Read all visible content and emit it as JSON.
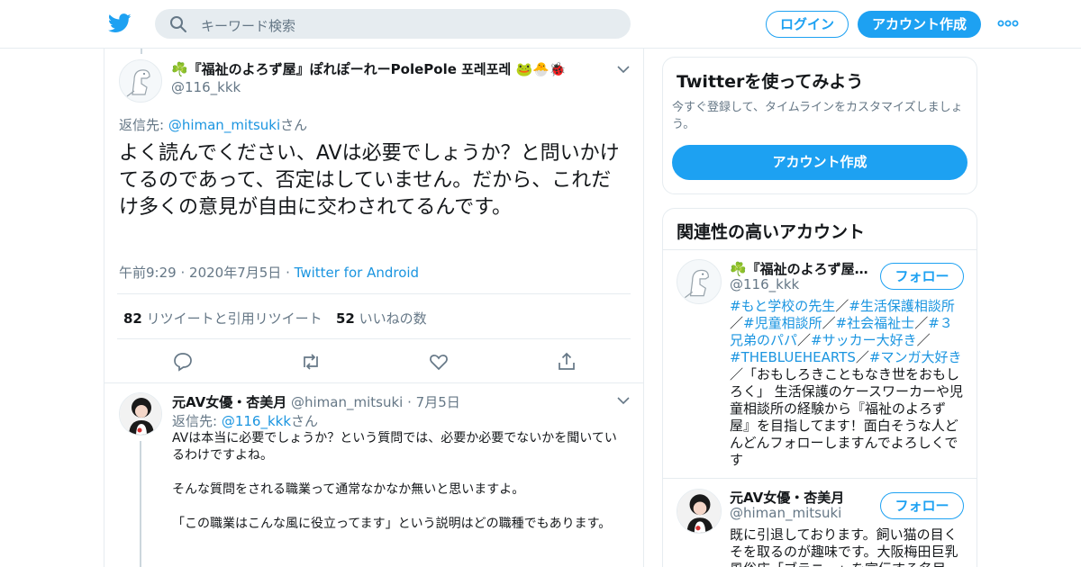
{
  "topbar": {
    "search_placeholder": "キーワード検索",
    "login": "ログイン",
    "signup": "アカウント作成"
  },
  "tweet": {
    "name": "☘️『福祉のよろず屋』ぽれぽーれーPolePole 포레포레",
    "emoji": "🐸🐣🐞",
    "handle": "@116_kkk",
    "reply_prefix": "返信先: ",
    "reply_link": "@himan_mitsuki",
    "reply_suffix": "さん",
    "text": "よく読んでください、AVは必要でしょうか？と問いかけてるのであって、否定はしていません。だから、これだけ多くの意見が自由に交わされてるんです。",
    "time": "午前9:29",
    "date": "2020年7月5日",
    "source": "Twitter for Android",
    "retweets_count": "82",
    "retweets_label": "リツイートと引用リツイート",
    "likes_count": "52",
    "likes_label": "いいねの数"
  },
  "reply": {
    "name": "元AV女優・杏美月",
    "handle": "@himan_mitsuki",
    "date": "7月5日",
    "reply_prefix": "返信先: ",
    "reply_link": "@116_kkk",
    "reply_suffix": "さん",
    "paragraphs": [
      "AVは本当に必要でしょうか？という質問では、必要か必要でないかを聞いているわけですよね。",
      "そんな質問をされる職業って通常なかなか無いと思いますよ。",
      "「この職業はこんな風に役立ってます」という説明はどの職種でもあります。"
    ]
  },
  "sidebar": {
    "try_title": "Twitterを使ってみよう",
    "try_desc": "今すぐ登録して、タイムラインをカスタマイズしましょう。",
    "try_button": "アカウント作成",
    "related_title": "関連性の高いアカウント",
    "follow_label": "フォロー",
    "accounts": [
      {
        "name": "☘️『福祉のよろず屋…",
        "handle": "@116_kkk",
        "bio_tags": [
          "#もと学校の先生",
          "#生活保護相談所",
          "#児童相談所",
          "#社会福祉士",
          "#３兄弟のパパ",
          "#サッカー大好き",
          "#THEBLUEHEARTS",
          "#マンガ大好き"
        ],
        "bio_text": "／「おもしろきこともなき世をおもしろく」 生活保護のケースワーカーや児童相談所の経験から『福祉のよろず屋』を目指してます！面白そうな人どんどんフォローしますんでよろしくです"
      },
      {
        "name": "元AV女優・杏美月",
        "handle": "@himan_mitsuki",
        "bio": "既に引退しております。飼い猫の目くそを取るのが趣味です。大阪梅田巨乳風俗店「ブラニー」を宣伝する名目で…"
      }
    ]
  },
  "colors": {
    "accent": "#1da1f2",
    "link": "#1b95e0",
    "secondary_text": "#657786",
    "border": "#e6ecf0"
  },
  "icons": [
    "twitter-logo-icon",
    "search-icon",
    "more-icon",
    "chevron-down-icon",
    "reply-icon",
    "retweet-icon",
    "like-icon",
    "share-icon"
  ]
}
